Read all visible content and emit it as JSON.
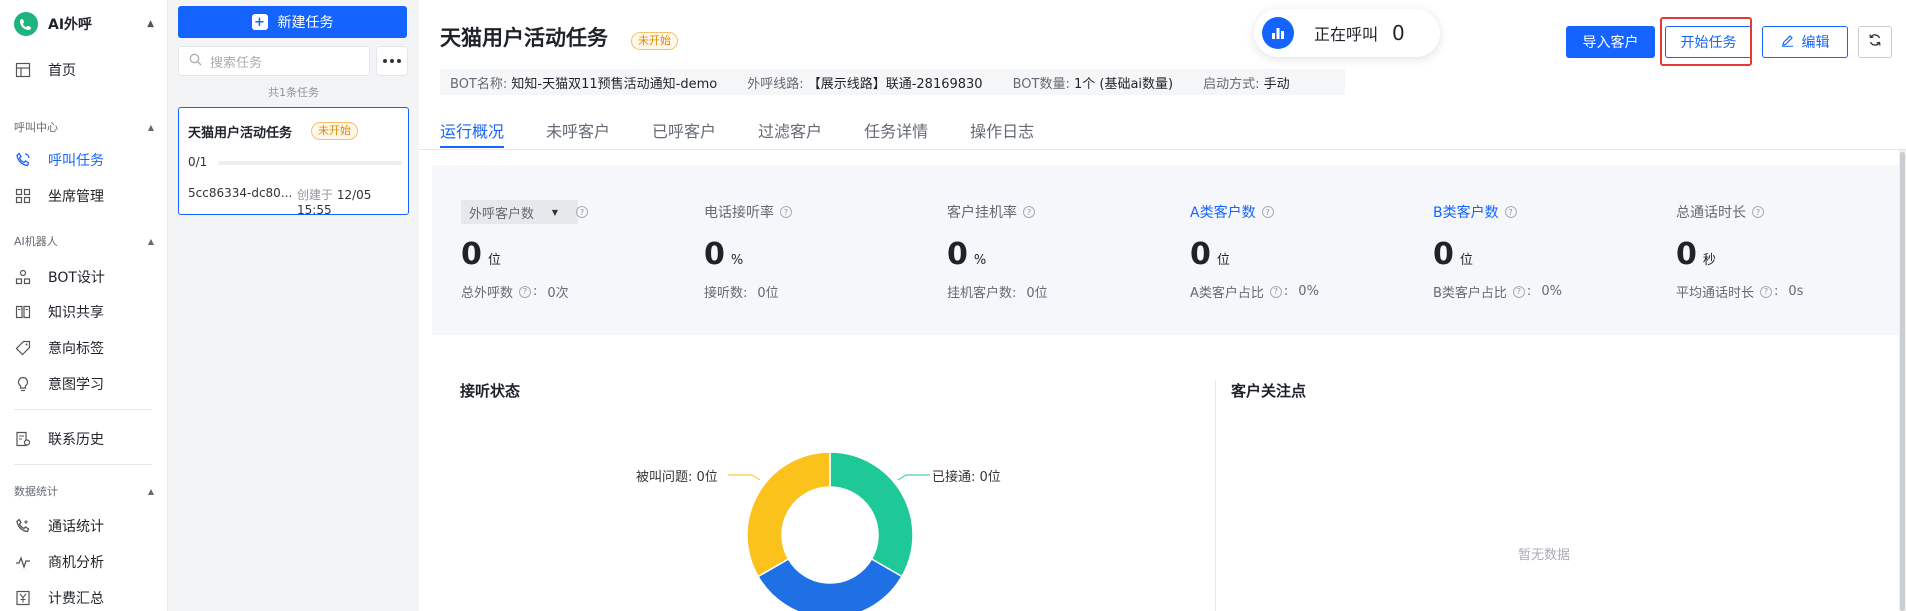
{
  "sidebar": {
    "brand": "AI外呼",
    "home": "首页",
    "groups": {
      "call_center": "呼叫中心",
      "ai_robot": "AI机器人",
      "data_stats": "数据统计"
    },
    "items": {
      "call_task": "呼叫任务",
      "seat_mgmt": "坐席管理",
      "bot_design": "BOT设计",
      "knowledge": "知识共享",
      "intent_tags": "意向标签",
      "intent_learning": "意图学习",
      "contact_history": "联系历史",
      "call_stats": "通话统计",
      "opportunity": "商机分析",
      "billing": "计费汇总"
    }
  },
  "tasklist": {
    "new_task": "新建任务",
    "search_placeholder": "搜索任务",
    "count": "共1条任务",
    "tasks": [
      {
        "name": "天猫用户活动任务",
        "status": "未开始",
        "progress": "0/1",
        "progress_fraction": 0,
        "id": "5cc86334-dc80...",
        "created_label": "创建于",
        "created_time": "12/05 15:55"
      }
    ]
  },
  "header": {
    "title": "天猫用户活动任务",
    "status": "未开始",
    "meta": {
      "bot_name_key": "BOT名称:",
      "bot_name": "知知-天猫双11预售活动通知-demo",
      "line_key": "外呼线路:",
      "line": "【展示线路】联通-28169830",
      "bot_count_key": "BOT数量:",
      "bot_count": "1个 (基础ai数量)",
      "start_mode_key": "启动方式:",
      "start_mode": "手动"
    },
    "calling_label": "正在呼叫",
    "calling_count": "0",
    "buttons": {
      "import": "导入客户",
      "start": "开始任务",
      "edit": "编辑"
    }
  },
  "tabs": [
    "运行概况",
    "未呼客户",
    "已呼客户",
    "过滤客户",
    "任务详情",
    "操作日志"
  ],
  "stats": [
    {
      "label": "外呼客户数",
      "value": "0",
      "unit": "位",
      "sub_label": "总外呼数",
      "sub_value": "0次"
    },
    {
      "label": "电话接听率",
      "value": "0",
      "unit": "%",
      "sub_label": "接听数:",
      "sub_value": "0位"
    },
    {
      "label": "客户挂机率",
      "value": "0",
      "unit": "%",
      "sub_label": "挂机客户数:",
      "sub_value": "0位"
    },
    {
      "label": "A类客户数",
      "value": "0",
      "unit": "位",
      "sub_label": "A类客户占比",
      "sub_value": "0%"
    },
    {
      "label": "B类客户数",
      "value": "0",
      "unit": "位",
      "sub_label": "B类客户占比",
      "sub_value": "0%"
    },
    {
      "label": "总通话时长",
      "value": "0",
      "unit": "秒",
      "sub_label": "平均通话时长",
      "sub_value": "0s"
    }
  ],
  "panels": {
    "answer_status": "接听状态",
    "customer_focus": "客户关注点",
    "empty": "暂无数据"
  },
  "chart_data": {
    "type": "pie",
    "title": "接听状态",
    "labels": [
      "已接通: 0位",
      "被叫问题: 0位"
    ],
    "segments": [
      {
        "color": "#1ec997"
      },
      {
        "color": "#1f6fe5"
      },
      {
        "color": "#fcc21c"
      }
    ]
  },
  "colors": {
    "primary": "#1664ff",
    "warning": "#e08a00",
    "brand": "#1fb37f",
    "highlight_box": "#e53935"
  }
}
